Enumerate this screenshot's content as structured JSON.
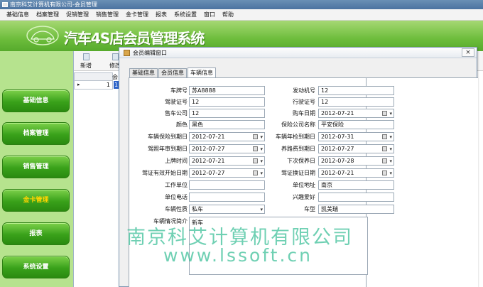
{
  "window": {
    "title": "南京科艾计算机有限公司-会员管理"
  },
  "menu": [
    "基础信息",
    "档案管理",
    "促销管理",
    "销售管理",
    "金卡管理",
    "报表",
    "系统设置",
    "窗口",
    "帮助"
  ],
  "banner": {
    "title": "汽车4S店会员管理系统"
  },
  "sidebar": {
    "items": [
      {
        "label": "基础信息"
      },
      {
        "label": "档案管理"
      },
      {
        "label": "销售管理"
      },
      {
        "label": "金卡管理",
        "active": true
      },
      {
        "label": "报表"
      },
      {
        "label": "系统设置"
      }
    ]
  },
  "toolbar": {
    "new_label": "新增",
    "edit_label": "修改"
  },
  "grid": {
    "header": "会",
    "row_marker": "▸",
    "row_value": "1",
    "row_selected": "1"
  },
  "dialog": {
    "title": "会员编辑窗口",
    "close": "×",
    "tabs": [
      {
        "label": "基础信息"
      },
      {
        "label": "会员信息"
      },
      {
        "label": "车辆信息",
        "active": true
      }
    ]
  },
  "form": {
    "plate_no": {
      "label": "车牌号",
      "value": "苏A8888"
    },
    "engine_no": {
      "label": "发动机号",
      "value": "12"
    },
    "driving_license": {
      "label": "驾驶证号",
      "value": "12"
    },
    "vehicle_license": {
      "label": "行驶证号",
      "value": "12"
    },
    "sale_company": {
      "label": "售车公司",
      "value": "12"
    },
    "purchase_date": {
      "label": "购车日期",
      "value": "2012-07-21"
    },
    "color": {
      "label": "颜色",
      "value": "黑色"
    },
    "insurer": {
      "label": "保险公司名称",
      "value": "平安保险"
    },
    "insurance_expiry": {
      "label": "车辆保险到期日",
      "value": "2012-07-21"
    },
    "annual_check_expiry": {
      "label": "车辆年检到期日",
      "value": "2012-07-31"
    },
    "license_review_expiry": {
      "label": "驾照年审到期日",
      "value": "2012-07-27"
    },
    "road_fee_expiry": {
      "label": "养路费到期日",
      "value": "2012-07-27"
    },
    "registration_time": {
      "label": "上牌时间",
      "value": "2012-07-21"
    },
    "next_service": {
      "label": "下次保养日",
      "value": "2012-07-28"
    },
    "license_valid_start": {
      "label": "驾证有效开始日期",
      "value": "2012-07-27"
    },
    "license_renewal": {
      "label": "驾证换证日期",
      "value": "2012-07-21"
    },
    "work_unit": {
      "label": "工作单位",
      "value": ""
    },
    "unit_address": {
      "label": "单位地址",
      "value": "南京"
    },
    "unit_phone": {
      "label": "单位电话",
      "value": ""
    },
    "hobbies": {
      "label": "兴趣爱好",
      "value": ""
    },
    "vehicle_nature": {
      "label": "车辆性质",
      "value": "私车"
    },
    "model": {
      "label": "车型",
      "value": "凯美瑞"
    },
    "vehicle_intro": {
      "label": "车辆情况简介",
      "value": "新车"
    }
  },
  "watermark": {
    "line1": "南京科艾计算机有限公司",
    "line2": "www.lssoft.cn"
  },
  "colors": {
    "banner": "#6dbd3c",
    "sidebar": "#b6e38e",
    "nav_button": "#39a11a",
    "active_nav_text": "#ffd400",
    "watermark": "#37be96"
  }
}
